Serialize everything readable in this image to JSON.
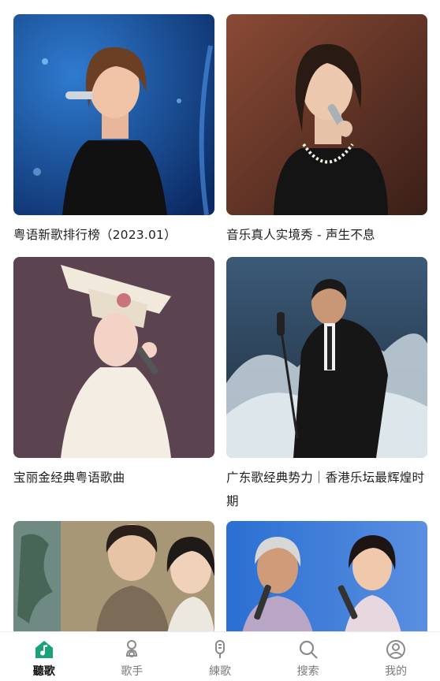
{
  "cards": [
    {
      "title": "粤语新歌排行榜（2023.01）"
    },
    {
      "title": "音乐真人实境秀 - 声生不息"
    },
    {
      "title": "宝丽金经典粤语歌曲"
    },
    {
      "title": "广东歌经典势力｜香港乐坛最辉煌时期"
    },
    {
      "title": ""
    },
    {
      "title": ""
    }
  ],
  "tabs": [
    {
      "label": "聽歌",
      "icon": "music-note-icon",
      "active": true
    },
    {
      "label": "歌手",
      "icon": "singer-icon",
      "active": false
    },
    {
      "label": "練歌",
      "icon": "microphone-icon",
      "active": false
    },
    {
      "label": "搜索",
      "icon": "search-icon",
      "active": false
    },
    {
      "label": "我的",
      "icon": "profile-icon",
      "active": false
    }
  ],
  "colors": {
    "accent": "#1aa37a"
  }
}
